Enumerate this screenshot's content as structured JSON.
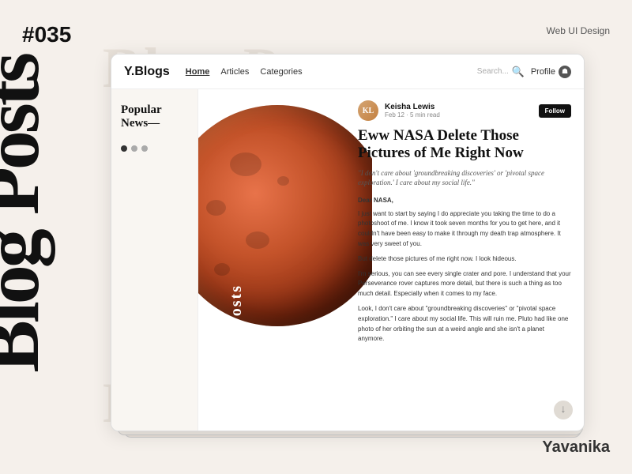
{
  "page": {
    "number": "#035",
    "category": "Web UI Design",
    "credit": "Yavanika"
  },
  "background": {
    "text_top": "Blog Posts",
    "text_bottom": "Blog Posts"
  },
  "vertical_title": "Blog Posts",
  "browser_vertical_label": "Blog Posts",
  "nav": {
    "brand": "Y.Blogs",
    "links": [
      {
        "label": "Home",
        "active": true
      },
      {
        "label": "Articles",
        "active": false
      },
      {
        "label": "Categories",
        "active": false
      }
    ],
    "search_placeholder": "Search...",
    "profile_label": "Profile"
  },
  "sidebar": {
    "title": "Popular News—",
    "dots": [
      "dark",
      "gray",
      "gray"
    ]
  },
  "article": {
    "author": {
      "name": "Keisha Lewis",
      "date": "Feb 12 · 5 min read",
      "avatar_initials": "KL"
    },
    "follow_label": "Follow",
    "title": "Eww NASA Delete Those Pictures of Me Right Now",
    "subtitle": "\"I don't care about 'groundbreaking discoveries' or 'pivotal space exploration.' I care about my social life.\"",
    "salutation": "Dear NASA,",
    "paragraphs": [
      "I just want to start by saying I do appreciate you taking the time to do a photoshoot of me. I know it took seven months for you to get here, and it couldn't have been easy to make it through my death trap atmosphere. It was very sweet of you.",
      "But delete those pictures of me right now. I look hideous.",
      "I'm serious, you can see every single crater and pore. I understand that your Perseverance rover captures more detail, but there is such a thing as too much detail. Especially when it comes to my face.",
      "Look, I don't care about \"groundbreaking discoveries\" or \"pivotal space exploration.\" I care about my social life. This will ruin me. Pluto had like one photo of her orbiting the sun at a weird angle and she isn't a planet anymore."
    ]
  },
  "icons": {
    "search": "🔍",
    "user": "👤",
    "scroll_down": "↓"
  }
}
